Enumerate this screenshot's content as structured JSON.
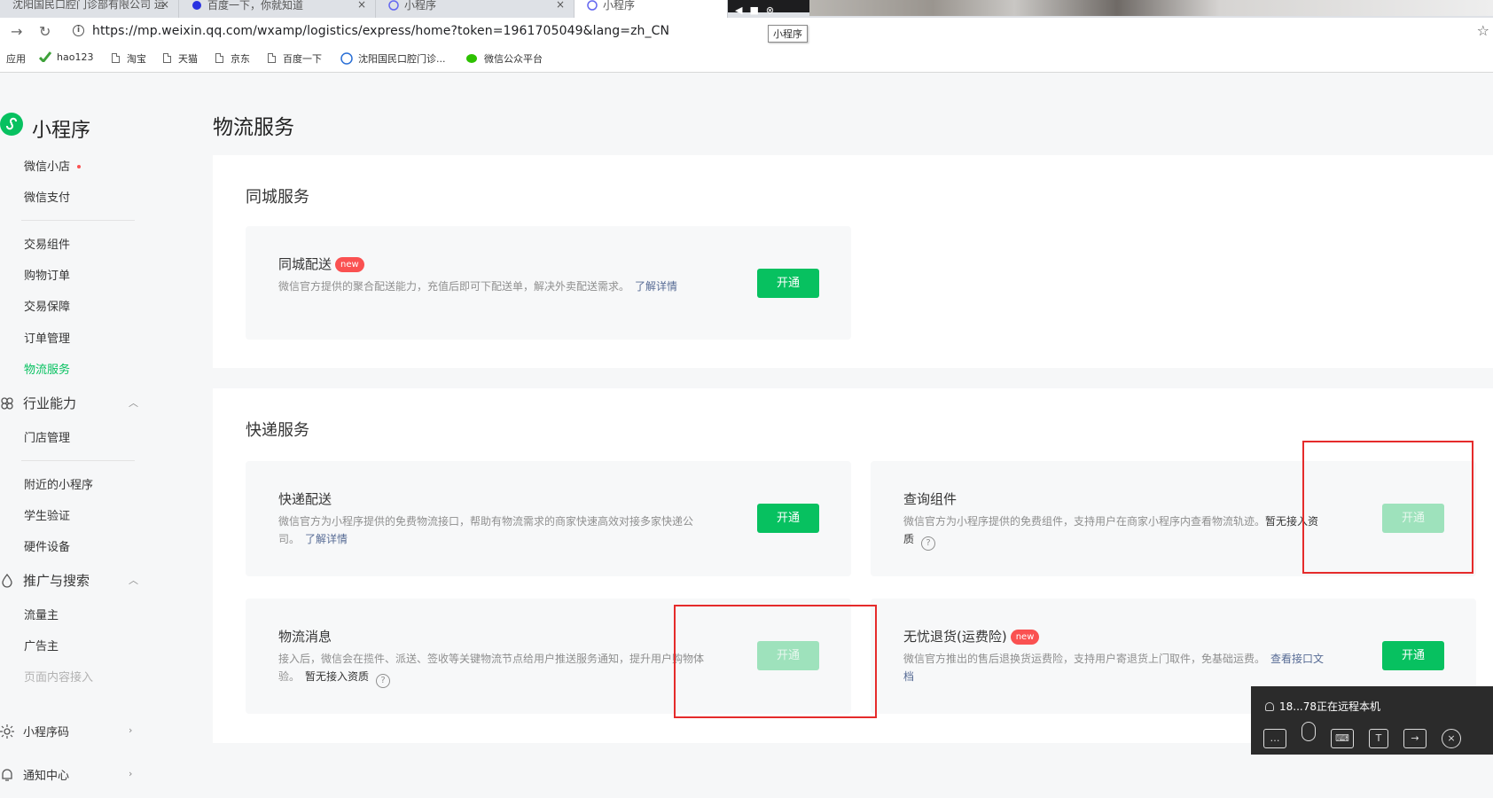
{
  "browser": {
    "tabs": [
      {
        "title": "沈阳国民口腔门诊部有限公司 运",
        "close": "×"
      },
      {
        "title": "百度一下，你就知道",
        "close": "×"
      },
      {
        "title": "小程序",
        "close": "×"
      },
      {
        "title": "小程序",
        "close": ""
      }
    ],
    "url": "https://mp.weixin.qq.com/wxamp/logistics/express/home?token=1961705049&lang=zh_CN",
    "tooltip": "小程序",
    "bookmarks": [
      "应用",
      "hao123",
      "淘宝",
      "天猫",
      "京东",
      "百度一下",
      "沈阳国民口腔门诊...",
      "微信公众平台"
    ]
  },
  "sidebar": {
    "brand": "小程序",
    "items": {
      "shop": "微信小店",
      "pay": "微信支付",
      "trade_component": "交易组件",
      "shopping_orders": "购物订单",
      "trade_guarantee": "交易保障",
      "order_management": "订单管理",
      "logistics": "物流服务",
      "store_management": "门店管理",
      "nearby": "附近的小程序",
      "student_verify": "学生验证",
      "hardware": "硬件设备",
      "traffic_owner": "流量主",
      "advertiser": "广告主",
      "page_content": "页面内容接入"
    },
    "groups": {
      "industry": "行业能力",
      "promotion": "推广与搜索",
      "qrcode": "小程序码",
      "notifications": "通知中心"
    }
  },
  "main": {
    "page_title": "物流服务",
    "same_city": {
      "section_title": "同城服务",
      "delivery": {
        "title": "同城配送",
        "badge": "new",
        "desc": "微信官方提供的聚合配送能力，充值后即可下配送单，解决外卖配送需求。",
        "link": "了解详情",
        "button": "开通"
      }
    },
    "express": {
      "section_title": "快递服务",
      "express_delivery": {
        "title": "快递配送",
        "desc": "微信官方为小程序提供的免费物流接口，帮助有物流需求的商家快速高效对接多家快递公司。",
        "link": "了解详情",
        "button": "开通"
      },
      "query_component": {
        "title": "查询组件",
        "desc": "微信官方为小程序提供的免费组件，支持用户在商家小程序内查看物流轨迹。",
        "status": "暂无接入资质",
        "help": "?",
        "button": "开通"
      },
      "logistics_message": {
        "title": "物流消息",
        "desc": "接入后，微信会在揽件、派送、签收等关键物流节点给用户推送服务通知，提升用户购物体验。",
        "status": "暂无接入资质",
        "help": "?",
        "button": "开通"
      },
      "return_insurance": {
        "title": "无忧退货(运费险)",
        "badge": "new",
        "desc": "微信官方推出的售后退换货运费险，支持用户寄退货上门取件，免基础运费。",
        "link": "查看接口文档",
        "button": "开通"
      }
    }
  },
  "remote": {
    "status": "18...78正在远程本机"
  },
  "colors": {
    "brand_green": "#07c160",
    "disabled_green": "#9ee2bc",
    "badge_red": "#fa5151",
    "annotation_red": "#e52b2b",
    "link_blue": "#576b95"
  }
}
